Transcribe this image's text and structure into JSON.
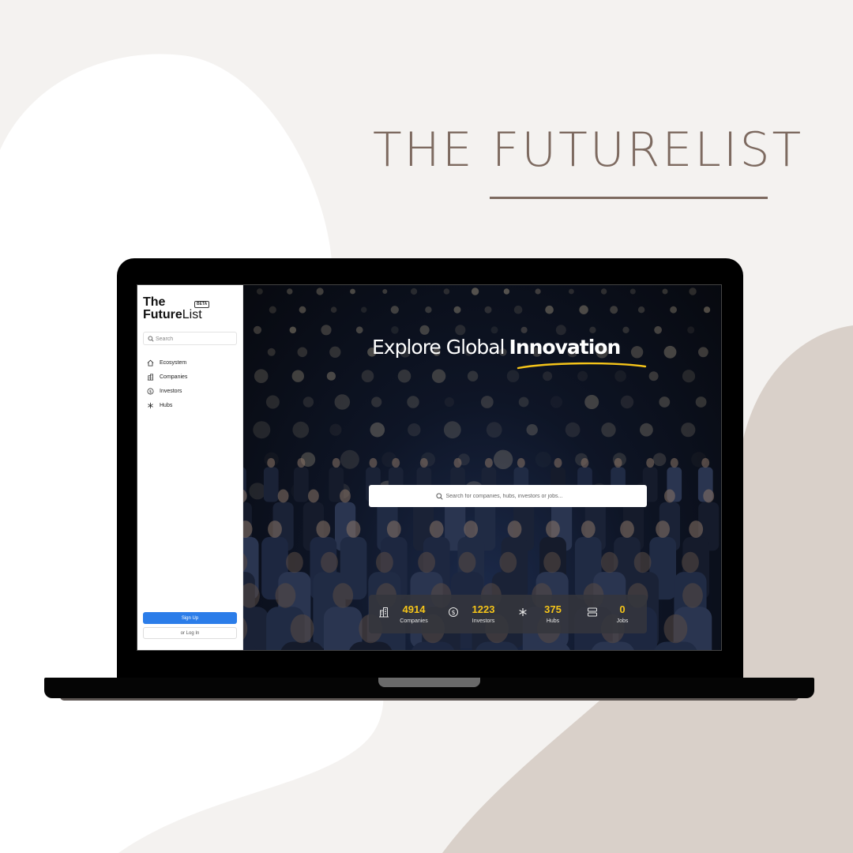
{
  "promo": {
    "title": "THE FUTURELIST",
    "colors": {
      "background": "#f4f2f0",
      "blob_light": "#ffffff",
      "blob_taupe": "#d9d0c9",
      "accent": "#7d6a60"
    }
  },
  "app": {
    "logo": {
      "line1": "The",
      "line2_bold": "Future",
      "line2_light": "List",
      "badge": "BETA"
    },
    "sidebar": {
      "search_placeholder": "Search",
      "items": [
        {
          "label": "Ecosystem",
          "icon": "home-icon"
        },
        {
          "label": "Companies",
          "icon": "building-icon"
        },
        {
          "label": "Investors",
          "icon": "dollar-coin-icon"
        },
        {
          "label": "Hubs",
          "icon": "asterisk-icon"
        }
      ],
      "signup_label": "Sign Up",
      "login_label": "or Log In"
    },
    "hero": {
      "title_regular": "Explore Global",
      "title_bold": "Innovation",
      "search_placeholder": "Search for companies, hubs, investors or jobs...",
      "underline_color": "#f5c419",
      "stats": [
        {
          "value": "4914",
          "label": "Companies",
          "icon": "building-icon"
        },
        {
          "value": "1223",
          "label": "Investors",
          "icon": "dollar-coin-icon"
        },
        {
          "value": "375",
          "label": "Hubs",
          "icon": "asterisk-icon"
        },
        {
          "value": "0",
          "label": "Jobs",
          "icon": "stack-icon"
        }
      ]
    },
    "colors": {
      "primary_button": "#2b7de9",
      "stat_number": "#f5c419"
    }
  }
}
